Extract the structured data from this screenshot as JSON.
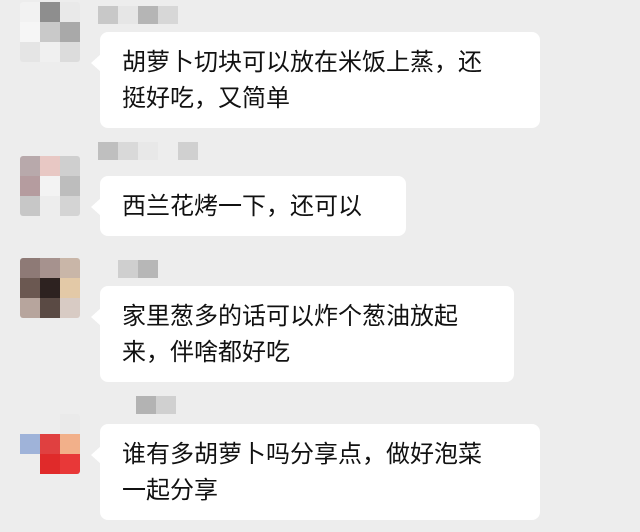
{
  "colors": {
    "background": "#ededed",
    "bubble": "#ffffff",
    "text": "#111111"
  },
  "messages": [
    {
      "text": "胡萝卜切块可以放在米饭上蒸，还\n挺好吃，又简单"
    },
    {
      "text": "西兰花烤一下，还可以"
    },
    {
      "text": "家里葱多的话可以炸个葱油放起\n来，伴啥都好吃"
    },
    {
      "text": "谁有多胡萝卜吗分享点，做好泡菜\n一起分享"
    }
  ]
}
